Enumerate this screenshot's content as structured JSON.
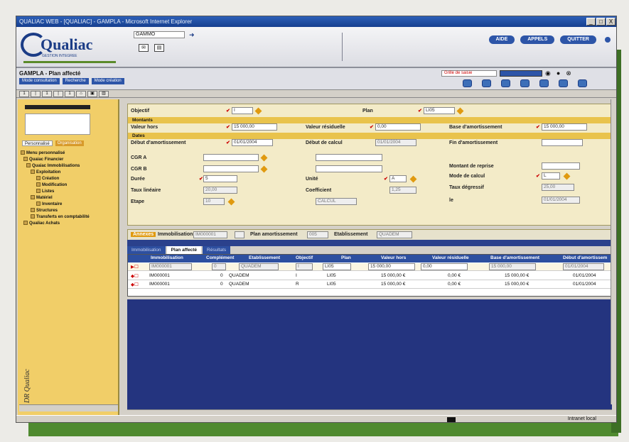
{
  "window": {
    "title": "QUALIAC WEB - [QUALIAC] - GAMPLA - Microsoft Internet Explorer",
    "controls": [
      "_",
      "□",
      "X"
    ]
  },
  "header": {
    "brand": "Qualiac",
    "brand_sub": "GESTION INTEGREE",
    "field_value": "GAMMO",
    "buttons": [
      "AIDE",
      "APPELS",
      "QUITTER"
    ]
  },
  "screen": {
    "title": "GAMPLA - Plan affecté",
    "modes": [
      "Mode consultation",
      "Recherche",
      "Mode création"
    ],
    "grid_field": "Grille de saisie",
    "nav": [
      "1",
      "|",
      "1",
      "|",
      "1"
    ]
  },
  "sidebar": {
    "tabs": [
      "Personnalisé",
      "Organisation"
    ],
    "tree": [
      "Menu personnalisé",
      "Quaiac Financier",
      "Quaiac Immobilisations",
      "Exploitation",
      "Création",
      "Modification",
      "Listes",
      "Matériel",
      "Inventaire",
      "Structures",
      "Transferts en comptabilité",
      "Qualiac Achats"
    ],
    "footer": "DR Qualiac"
  },
  "form": {
    "objectif_label": "Objectif",
    "objectif_value": "I",
    "plan_label": "Plan",
    "plan_value": "LI05",
    "montants_band": "Montants",
    "valeur_hors_label": "Valeur hors",
    "valeur_hors_value": "15 000,00",
    "valeur_residuelle_label": "Valeur résiduelle",
    "valeur_residuelle_value": "0,00",
    "base_amort_label": "Base d'amortissement",
    "base_amort_value": "15 000,00",
    "dates_band": "Dates",
    "debut_amort_label": "Début d'amortissement",
    "debut_amort_value": "01/01/2004",
    "debut_calcul_label": "Début de calcul",
    "debut_calcul_value": "01/01/2004",
    "fin_amort_label": "Fin d'amortissement",
    "fin_amort_value": "",
    "cgr_a_label": "CGR A",
    "cgr_b_label": "CGR B",
    "montant_reprise_label": "Montant de reprise",
    "duree_label": "Durée",
    "duree_value": "5",
    "unite_label": "Unité",
    "unite_value": "A",
    "mode_calcul_label": "Mode de calcul",
    "mode_calcul_value": "L",
    "taux_lineaire_label": "Taux linéaire",
    "taux_lineaire_value": "20,00",
    "coefficient_label": "Coefficient",
    "coefficient_value": "1,25",
    "taux_degressif_label": "Taux dégressif",
    "taux_degressif_value": "25,00",
    "etape_label": "Etape",
    "etape_value": "10",
    "etape_desc": "CALCUL",
    "le_label": "le",
    "le_value": "01/01/2004"
  },
  "footer_bar": {
    "btn": "Annexes",
    "immobilisation_label": "Immobilisation",
    "immobilisation_value": "IM000001",
    "plan_amort_label": "Plan amortissement",
    "plan_amort_value": "005",
    "etablissement_label": "Etablissement",
    "etablissement_value": "QUADEM"
  },
  "tabs": [
    "Immobilisation",
    "Plan affecté",
    "Résultats"
  ],
  "grid": {
    "headers": [
      "Immobilisation",
      "Complément",
      "Etablissement",
      "Objectif",
      "Plan",
      "Valeur hors",
      "Valeur résiduelle",
      "Base d'amortissement",
      "Début d'amortissem"
    ],
    "edit_row": [
      "IM000001",
      "0",
      "QUADEM",
      "I",
      "LI05",
      "15 000,00",
      "0,00",
      "15 000,00",
      "01/01/2004"
    ],
    "rows": [
      [
        "IM000001",
        "0",
        "QUADEM",
        "I",
        "LI05",
        "15 000,00 €",
        "0,00 €",
        "15 000,00 €",
        "01/01/2004"
      ],
      [
        "IM000001",
        "0",
        "QUADEM",
        "R",
        "LI05",
        "15 000,00 €",
        "0,00 €",
        "15 000,00 €",
        "01/01/2004"
      ]
    ]
  },
  "status": {
    "zone": "Intranet local"
  }
}
